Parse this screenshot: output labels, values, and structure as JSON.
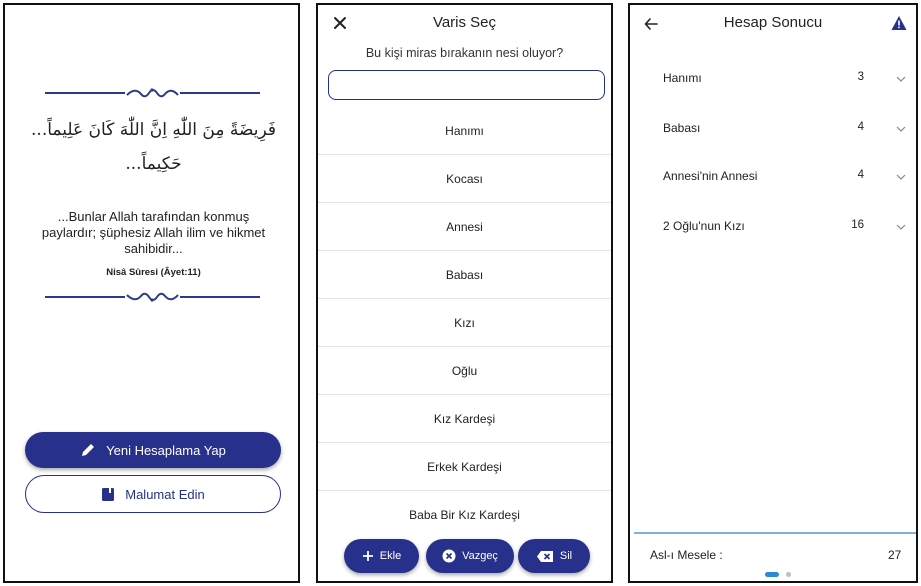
{
  "screen1": {
    "arabic_verse": "فَرِيضَةً مِنَ اللّٰهِ اِنَّ اللّٰهَ كَانَ عَلِيماً... حَكِيماً...",
    "meaning": "...Bunlar Allah tarafından konmuş paylardır; şüphesiz Allah ilim ve hikmet sahibidir...",
    "source": "Nisâ Sûresi (Âyet:11)",
    "new_calc_label": "Yeni Hesaplama Yap",
    "info_label": "Malumat Edin",
    "accent_color": "#27308a",
    "icons": [
      "pencil-icon",
      "book-icon"
    ]
  },
  "screen2": {
    "title": "Varis Seç",
    "question": "Bu kişi miras bırakanın nesi oluyor?",
    "search_value": "",
    "heirs": [
      "Hanımı",
      "Kocası",
      "Annesi",
      "Babası",
      "Kızı",
      "Oğlu",
      "Kız Kardeşi",
      "Erkek Kardeşi",
      "Baba Bir Kız Kardeşi"
    ],
    "actions": {
      "add": "Ekle",
      "cancel": "Vazgeç",
      "delete": "Sil"
    },
    "icons": [
      "close-icon",
      "plus-icon",
      "cancel-circle-icon",
      "backspace-icon"
    ]
  },
  "screen3": {
    "title": "Hesap Sonucu",
    "results": [
      {
        "name": "Hanımı",
        "share": "3"
      },
      {
        "name": "Babası",
        "share": "4"
      },
      {
        "name": "Annesi'nin Annesi",
        "share": "4"
      },
      {
        "name": "2 Oğlu'nun Kızı",
        "share": "16"
      }
    ],
    "footer_label": "Asl-ı Mesele :",
    "footer_value": "27",
    "page_index": 1,
    "page_count": 2,
    "divider_color": "#7fb0e0",
    "icons": [
      "back-arrow-icon",
      "warning-icon",
      "chevron-down-icon"
    ]
  }
}
